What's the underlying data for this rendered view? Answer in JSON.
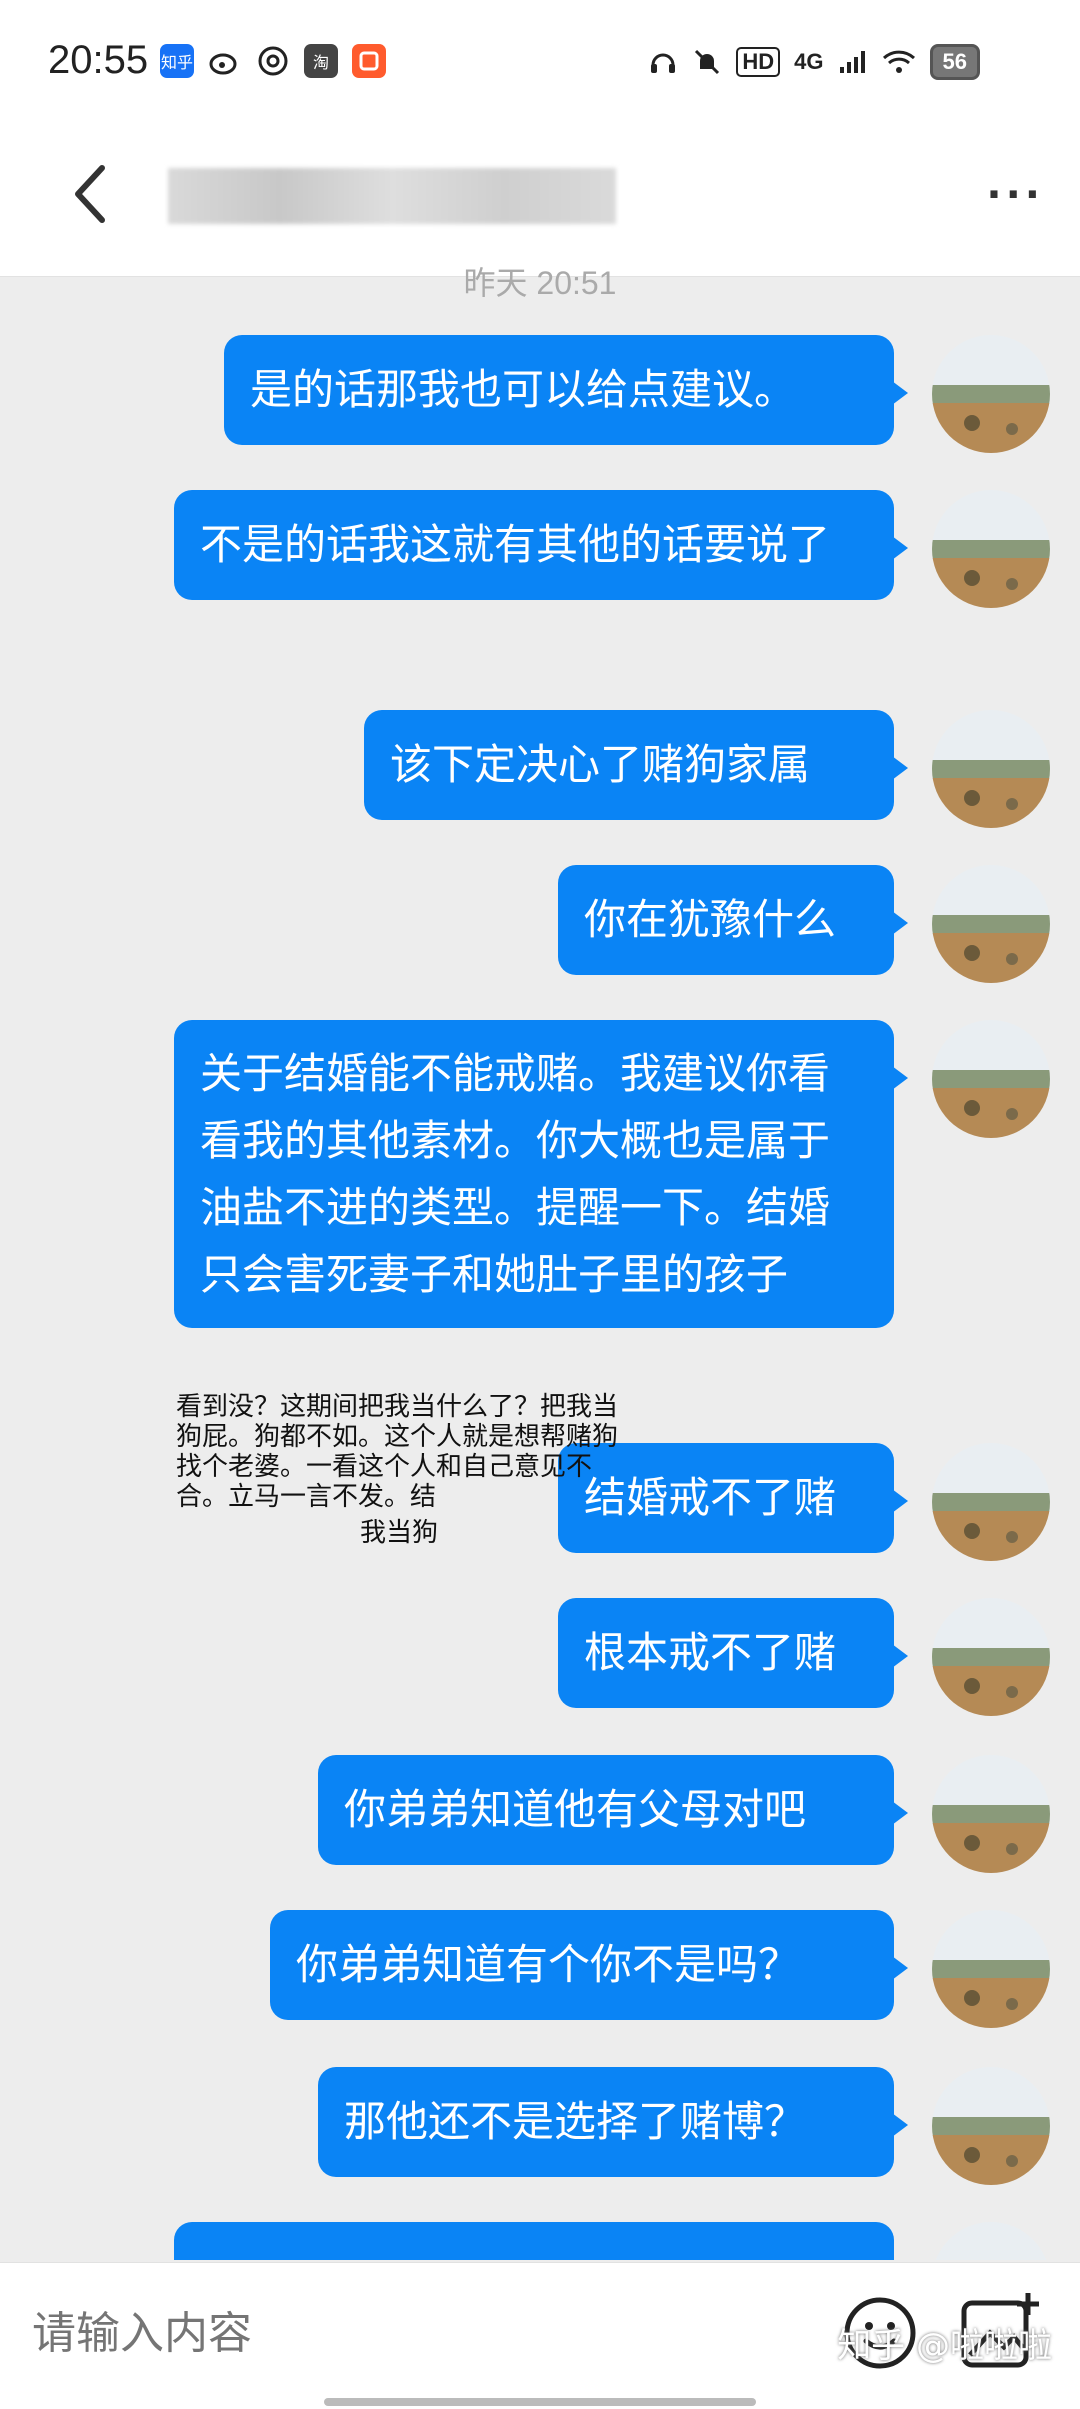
{
  "status": {
    "time": "20:55",
    "app_icons": [
      {
        "icon": "zhihu-icon",
        "label": "知乎",
        "color": "#1772f6"
      },
      {
        "icon": "weibo-icon",
        "label": "",
        "color": "#ffffff"
      },
      {
        "icon": "netease-music-icon",
        "label": "",
        "color": "#ffffff"
      },
      {
        "icon": "taobao-icon",
        "label": "淘",
        "color": "#444444"
      },
      {
        "icon": "xiaohongshu-icon",
        "label": "",
        "color": "#ff5b2d"
      }
    ],
    "network": "4G",
    "battery": "56"
  },
  "header": {
    "contact_name": "",
    "more_label": "···"
  },
  "chat": {
    "timestamp": "昨天 20:51",
    "messages": [
      {
        "text": "是的话那我也可以给点建议。"
      },
      {
        "text": "不是的话我这就有其他的话要说了"
      },
      {
        "text": "该下定决心了赌狗家属"
      },
      {
        "text": "你在犹豫什么"
      },
      {
        "text": "关于结婚能不能戒赌。我建议你看看我的其他素材。你大概也是属于油盐不进的类型。提醒一下。结婚只会害死妻子和她肚子里的孩子"
      },
      {
        "text": "结婚戒不了赌"
      },
      {
        "text": "根本戒不了赌"
      },
      {
        "text": "你弟弟知道他有父母对吧"
      },
      {
        "text": "你弟弟知道有个你不是吗？"
      },
      {
        "text": "那他还不是选择了赌博？"
      }
    ],
    "annotation": "看到没？这期间把我当什么了？把我当狗屁。狗都不如。这个人就是想帮赌狗找个老婆。一看这个人和自己意见不合。立马一言不发。结",
    "annotation_tail": "我当狗"
  },
  "input": {
    "placeholder": "请输入内容"
  },
  "watermark": "知乎 @啦啦啦",
  "colors": {
    "bubble": "#0a84f5",
    "background": "#ededed"
  }
}
